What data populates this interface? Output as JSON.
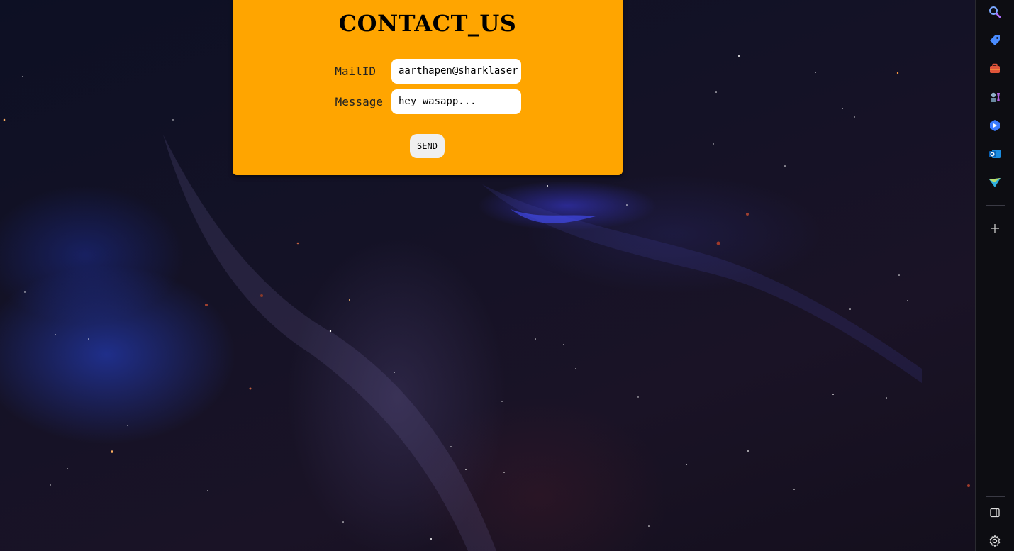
{
  "contact_form": {
    "title": "CONTACT_US",
    "mail_label": "MailID",
    "mail_value": "aarthapen@sharklaser",
    "message_label": "Message",
    "message_value": "hey wasapp...",
    "send_label": "SEND"
  },
  "colors": {
    "card_background": "#ffa500",
    "page_background": "#110f1f",
    "sidebar_background": "#0d0d12"
  },
  "sidebar": {
    "items": [
      {
        "icon": "search-icon"
      },
      {
        "icon": "shopping-tag-icon"
      },
      {
        "icon": "tools-briefcase-icon"
      },
      {
        "icon": "games-icon"
      },
      {
        "icon": "copilot-icon"
      },
      {
        "icon": "outlook-icon"
      },
      {
        "icon": "send-icon"
      },
      {
        "icon": "add-icon"
      },
      {
        "icon": "sidebar-toggle-icon"
      },
      {
        "icon": "gear-icon"
      }
    ]
  }
}
